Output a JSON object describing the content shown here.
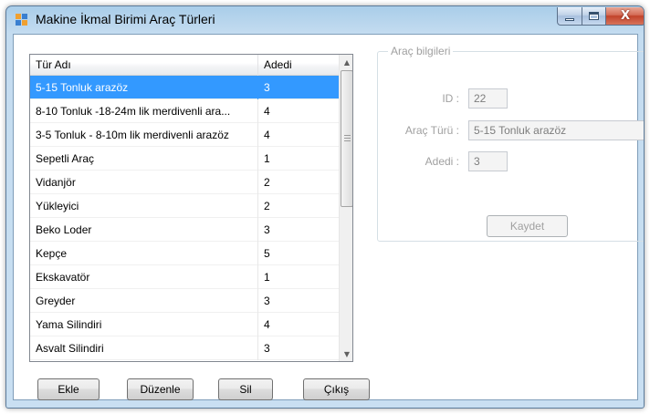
{
  "window": {
    "title": "Makine İkmal Birimi Araç Türleri",
    "close_glyph": "X",
    "accent": "#3399ff"
  },
  "grid": {
    "columns": [
      "Tür Adı",
      "Adedi"
    ],
    "selected_index": 0,
    "rows": [
      {
        "name": "5-15 Tonluk arazöz",
        "count": "3"
      },
      {
        "name": "8-10 Tonluk -18-24m lik merdivenli ara...",
        "count": "4"
      },
      {
        "name": "3-5 Tonluk - 8-10m lik merdivenli arazöz",
        "count": "4"
      },
      {
        "name": "Sepetli Araç",
        "count": "1"
      },
      {
        "name": "Vidanjör",
        "count": "2"
      },
      {
        "name": "Yükleyici",
        "count": "2"
      },
      {
        "name": "Beko Loder",
        "count": "3"
      },
      {
        "name": "Kepçe",
        "count": "5"
      },
      {
        "name": "Ekskavatör",
        "count": "1"
      },
      {
        "name": "Greyder",
        "count": "3"
      },
      {
        "name": "Yama Silindiri",
        "count": "4"
      },
      {
        "name": "Asvalt Silindiri",
        "count": "3"
      }
    ]
  },
  "buttons": {
    "add": "Ekle",
    "edit": "Düzenle",
    "delete": "Sil",
    "exit": "Çıkış"
  },
  "details": {
    "group_title": "Araç bilgileri",
    "id_label": "ID :",
    "id_value": "22",
    "type_label": "Araç Türü :",
    "type_value": "5-15 Tonluk arazöz",
    "count_label": "Adedi :",
    "count_value": "3",
    "save_label": "Kaydet"
  }
}
